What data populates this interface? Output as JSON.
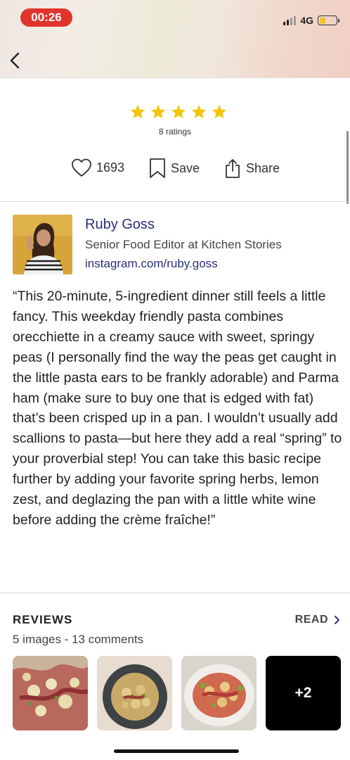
{
  "status_bar": {
    "time": "00:26",
    "network": "4G",
    "battery_level": 0.35
  },
  "rating": {
    "stars": 5,
    "count_label": "8 ratings",
    "star_color": "#f5c400"
  },
  "actions": {
    "likes": "1693",
    "save_label": "Save",
    "share_label": "Share"
  },
  "author": {
    "name": "Ruby Goss",
    "title": "Senior Food Editor at Kitchen Stories",
    "link": "instagram.com/ruby.goss"
  },
  "description": "“This 20-minute, 5-ingredient dinner still feels a little fancy. This weekday friendly pasta combines orecchiette in a creamy sauce with sweet, springy peas (I personally find the way the peas get caught in the little pasta ears to be frankly adorable) and Parma ham (make sure to buy one that is edged with fat) that’s been crisped up in a pan. I wouldn’t usually add scallions to pasta—but here they add a real “spring” to your proverbial step! You can take this basic recipe further by adding your favorite spring herbs, lemon zest, and deglazing the pan with a little white wine before adding the crème fraîche!”",
  "reviews": {
    "title": "REVIEWS",
    "read_label": "READ",
    "summary": "5 images - 13 comments",
    "more_label": "+2"
  },
  "colors": {
    "accent_link": "#2b2f7a",
    "time_pill": "#e0342d"
  }
}
